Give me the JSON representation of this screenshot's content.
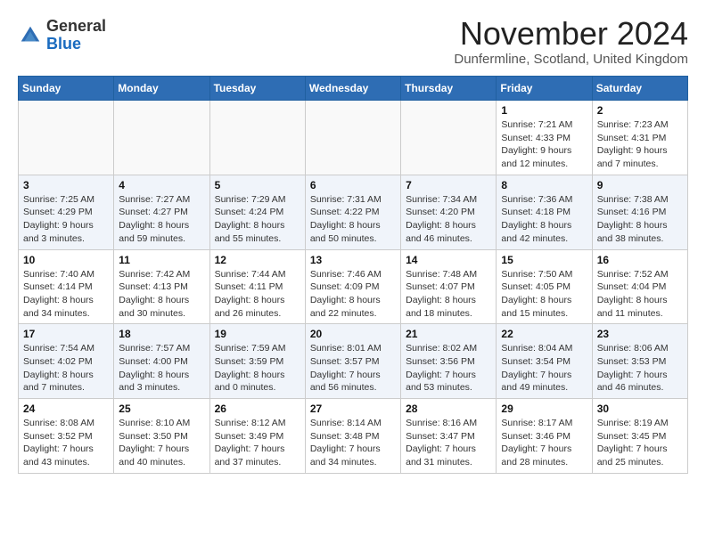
{
  "logo": {
    "general": "General",
    "blue": "Blue"
  },
  "title": "November 2024",
  "location": "Dunfermline, Scotland, United Kingdom",
  "days_of_week": [
    "Sunday",
    "Monday",
    "Tuesday",
    "Wednesday",
    "Thursday",
    "Friday",
    "Saturday"
  ],
  "weeks": [
    [
      {
        "day": "",
        "info": ""
      },
      {
        "day": "",
        "info": ""
      },
      {
        "day": "",
        "info": ""
      },
      {
        "day": "",
        "info": ""
      },
      {
        "day": "",
        "info": ""
      },
      {
        "day": "1",
        "info": "Sunrise: 7:21 AM\nSunset: 4:33 PM\nDaylight: 9 hours and 12 minutes."
      },
      {
        "day": "2",
        "info": "Sunrise: 7:23 AM\nSunset: 4:31 PM\nDaylight: 9 hours and 7 minutes."
      }
    ],
    [
      {
        "day": "3",
        "info": "Sunrise: 7:25 AM\nSunset: 4:29 PM\nDaylight: 9 hours and 3 minutes."
      },
      {
        "day": "4",
        "info": "Sunrise: 7:27 AM\nSunset: 4:27 PM\nDaylight: 8 hours and 59 minutes."
      },
      {
        "day": "5",
        "info": "Sunrise: 7:29 AM\nSunset: 4:24 PM\nDaylight: 8 hours and 55 minutes."
      },
      {
        "day": "6",
        "info": "Sunrise: 7:31 AM\nSunset: 4:22 PM\nDaylight: 8 hours and 50 minutes."
      },
      {
        "day": "7",
        "info": "Sunrise: 7:34 AM\nSunset: 4:20 PM\nDaylight: 8 hours and 46 minutes."
      },
      {
        "day": "8",
        "info": "Sunrise: 7:36 AM\nSunset: 4:18 PM\nDaylight: 8 hours and 42 minutes."
      },
      {
        "day": "9",
        "info": "Sunrise: 7:38 AM\nSunset: 4:16 PM\nDaylight: 8 hours and 38 minutes."
      }
    ],
    [
      {
        "day": "10",
        "info": "Sunrise: 7:40 AM\nSunset: 4:14 PM\nDaylight: 8 hours and 34 minutes."
      },
      {
        "day": "11",
        "info": "Sunrise: 7:42 AM\nSunset: 4:13 PM\nDaylight: 8 hours and 30 minutes."
      },
      {
        "day": "12",
        "info": "Sunrise: 7:44 AM\nSunset: 4:11 PM\nDaylight: 8 hours and 26 minutes."
      },
      {
        "day": "13",
        "info": "Sunrise: 7:46 AM\nSunset: 4:09 PM\nDaylight: 8 hours and 22 minutes."
      },
      {
        "day": "14",
        "info": "Sunrise: 7:48 AM\nSunset: 4:07 PM\nDaylight: 8 hours and 18 minutes."
      },
      {
        "day": "15",
        "info": "Sunrise: 7:50 AM\nSunset: 4:05 PM\nDaylight: 8 hours and 15 minutes."
      },
      {
        "day": "16",
        "info": "Sunrise: 7:52 AM\nSunset: 4:04 PM\nDaylight: 8 hours and 11 minutes."
      }
    ],
    [
      {
        "day": "17",
        "info": "Sunrise: 7:54 AM\nSunset: 4:02 PM\nDaylight: 8 hours and 7 minutes."
      },
      {
        "day": "18",
        "info": "Sunrise: 7:57 AM\nSunset: 4:00 PM\nDaylight: 8 hours and 3 minutes."
      },
      {
        "day": "19",
        "info": "Sunrise: 7:59 AM\nSunset: 3:59 PM\nDaylight: 8 hours and 0 minutes."
      },
      {
        "day": "20",
        "info": "Sunrise: 8:01 AM\nSunset: 3:57 PM\nDaylight: 7 hours and 56 minutes."
      },
      {
        "day": "21",
        "info": "Sunrise: 8:02 AM\nSunset: 3:56 PM\nDaylight: 7 hours and 53 minutes."
      },
      {
        "day": "22",
        "info": "Sunrise: 8:04 AM\nSunset: 3:54 PM\nDaylight: 7 hours and 49 minutes."
      },
      {
        "day": "23",
        "info": "Sunrise: 8:06 AM\nSunset: 3:53 PM\nDaylight: 7 hours and 46 minutes."
      }
    ],
    [
      {
        "day": "24",
        "info": "Sunrise: 8:08 AM\nSunset: 3:52 PM\nDaylight: 7 hours and 43 minutes."
      },
      {
        "day": "25",
        "info": "Sunrise: 8:10 AM\nSunset: 3:50 PM\nDaylight: 7 hours and 40 minutes."
      },
      {
        "day": "26",
        "info": "Sunrise: 8:12 AM\nSunset: 3:49 PM\nDaylight: 7 hours and 37 minutes."
      },
      {
        "day": "27",
        "info": "Sunrise: 8:14 AM\nSunset: 3:48 PM\nDaylight: 7 hours and 34 minutes."
      },
      {
        "day": "28",
        "info": "Sunrise: 8:16 AM\nSunset: 3:47 PM\nDaylight: 7 hours and 31 minutes."
      },
      {
        "day": "29",
        "info": "Sunrise: 8:17 AM\nSunset: 3:46 PM\nDaylight: 7 hours and 28 minutes."
      },
      {
        "day": "30",
        "info": "Sunrise: 8:19 AM\nSunset: 3:45 PM\nDaylight: 7 hours and 25 minutes."
      }
    ]
  ]
}
